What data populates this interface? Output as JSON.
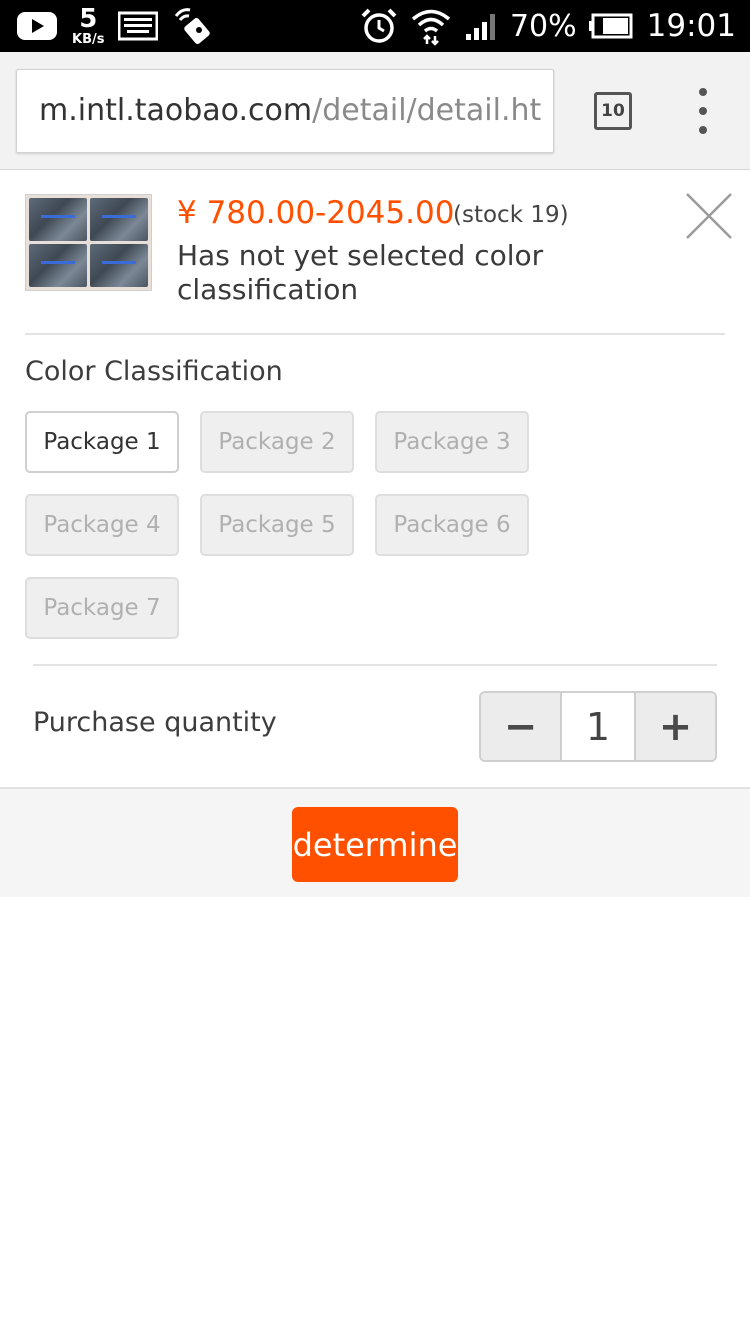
{
  "status_bar": {
    "net_speed_value": "5",
    "net_speed_unit": "KB/s",
    "battery_percent": "70%",
    "time": "19:01",
    "icons": [
      "youtube-icon",
      "keyboard-icon",
      "nfc-tag-icon",
      "alarm-icon",
      "wifi-icon",
      "signal-icon",
      "battery-icon"
    ]
  },
  "browser": {
    "url_host": "m.intl.taobao.com",
    "url_path": "/detail/detail.ht",
    "tab_count": "10"
  },
  "product": {
    "price": "¥ 780.00-2045.00",
    "stock": "(stock 19)",
    "selection_hint": "Has not yet selected color classification"
  },
  "sku": {
    "section_title": "Color Classification",
    "options": [
      {
        "label": "Package 1",
        "available": true
      },
      {
        "label": "Package 2",
        "available": false
      },
      {
        "label": "Package 3",
        "available": false
      },
      {
        "label": "Package 4",
        "available": false
      },
      {
        "label": "Package 5",
        "available": false
      },
      {
        "label": "Package 6",
        "available": false
      },
      {
        "label": "Package 7",
        "available": false
      }
    ]
  },
  "quantity": {
    "label": "Purchase quantity",
    "minus": "−",
    "value": "1",
    "plus": "+"
  },
  "footer": {
    "confirm_label": "determine"
  },
  "colors": {
    "accent": "#ff5000",
    "status_bar_bg": "#000000"
  }
}
